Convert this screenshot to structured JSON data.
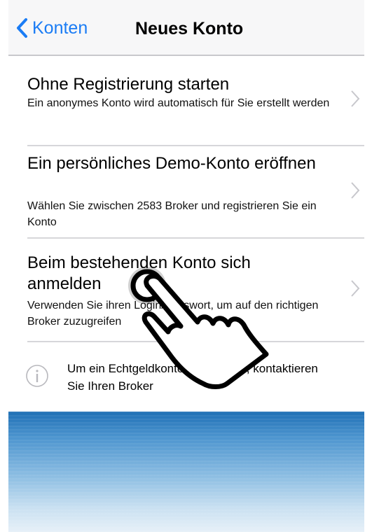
{
  "navbar": {
    "back_label": "Konten",
    "title": "Neues Konto"
  },
  "rows": [
    {
      "title": "Ohne Registrierung starten",
      "subtitle": "Ein anonymes Konto wird automatisch für Sie erstellt werden"
    },
    {
      "title": "Ein persönliches Demo-Konto eröffnen",
      "subtitle": "Wählen Sie zwischen 2583 Broker und registrieren Sie ein Konto"
    },
    {
      "title": "Beim bestehenden Konto sich anmelden",
      "subtitle": "Verwenden Sie ihren Login/Passwort, um auf den richtigen Broker zuzugreifen"
    }
  ],
  "info": {
    "text": "Um ein Echtgeldkonto zu eröffnen, kontaktieren Sie Ihren Broker"
  },
  "colors": {
    "accent": "#1a7cf5",
    "separator": "#d6d6da",
    "chevron": "#c7c7cc"
  },
  "icons": {
    "back": "chevron-left-icon",
    "row_disclosure": "chevron-right-icon",
    "info": "info-icon",
    "overlay": "tap-hand-icon"
  }
}
